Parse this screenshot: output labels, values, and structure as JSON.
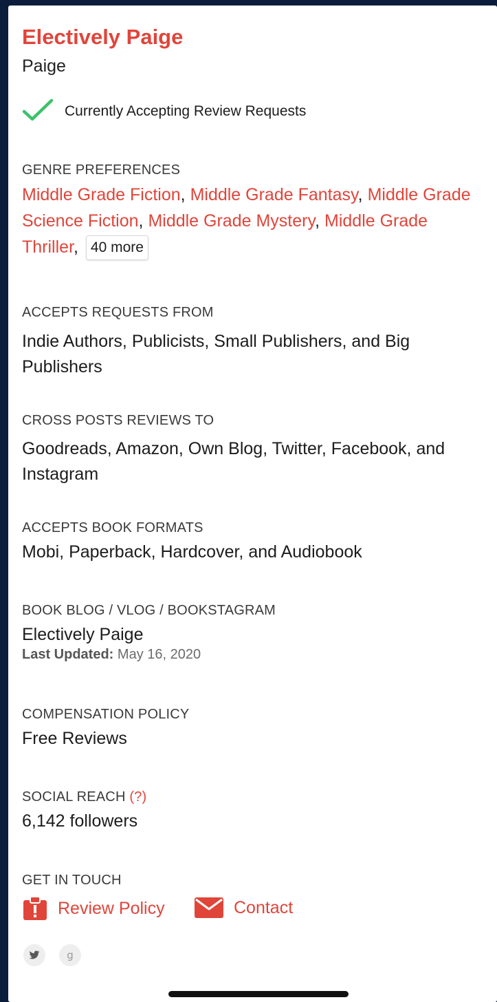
{
  "header": {
    "blog_name": "Electively Paige",
    "reviewer_name": "Paige",
    "status": "Currently Accepting Review Requests"
  },
  "genres": {
    "label": "GENRE PREFERENCES",
    "items": [
      "Middle Grade Fiction",
      "Middle Grade Fantasy",
      "Middle Grade Science Fiction",
      "Middle Grade Mystery",
      "Middle Grade Thriller"
    ],
    "more_label": "40 more"
  },
  "requests": {
    "label": "ACCEPTS REQUESTS FROM",
    "value": "Indie Authors, Publicists, Small Publishers, and Big Publishers"
  },
  "cross_posts": {
    "label": "CROSS POSTS REVIEWS TO",
    "value": "Goodreads, Amazon, Own Blog, Twitter, Facebook, and Instagram"
  },
  "formats": {
    "label": "ACCEPTS BOOK FORMATS",
    "value": "Mobi, Paperback, Hardcover, and Audiobook"
  },
  "blog": {
    "label": "BOOK BLOG / VLOG / BOOKSTAGRAM",
    "link": "Electively Paige",
    "updated_label": "Last Updated:",
    "updated_value": "May 16, 2020"
  },
  "compensation": {
    "label": "COMPENSATION POLICY",
    "value": "Free Reviews"
  },
  "social": {
    "label": "SOCIAL REACH",
    "help": "(?)",
    "value": "6,142 followers"
  },
  "contact": {
    "label": "GET IN TOUCH",
    "review_policy": "Review Policy",
    "contact": "Contact"
  },
  "social_icons": [
    "twitter-icon",
    "goodreads-icon"
  ],
  "colors": {
    "accent": "#e0453a",
    "check": "#3cc26a",
    "background": "#0b1d3a"
  }
}
